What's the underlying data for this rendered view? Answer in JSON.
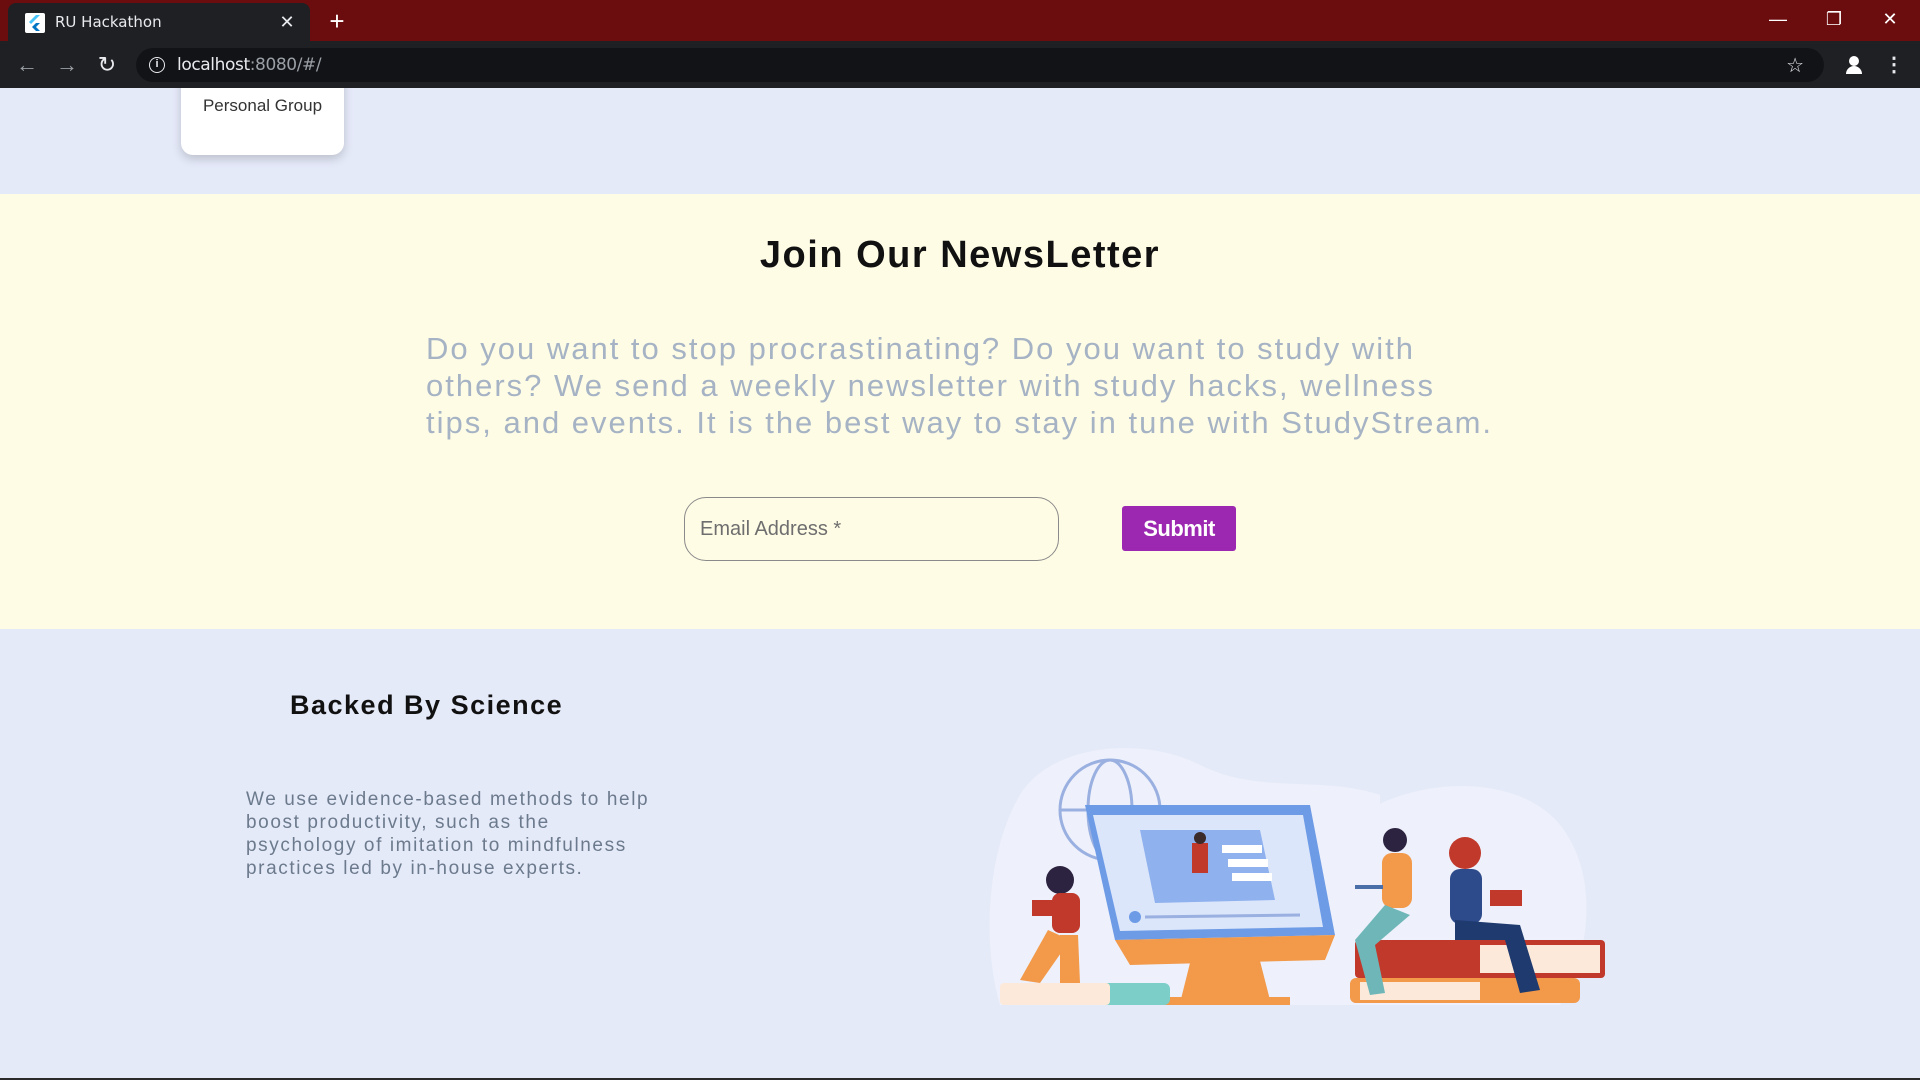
{
  "browser": {
    "tab_title": "RU Hackathon",
    "tab_close": "✕",
    "new_tab": "+",
    "url_host": "localhost",
    "url_rest": ":8080/#/",
    "window_controls": {
      "minimize": "—",
      "restore": "❐",
      "close": "✕"
    }
  },
  "card": {
    "label": "Personal Group"
  },
  "newsletter": {
    "title": "Join Our NewsLetter",
    "body": "Do you want to stop procrastinating? Do you want to study with others? We send a weekly newsletter with study hacks, wellness tips, and events. It is the best way to stay in tune with StudyStream.",
    "email_placeholder": "Email Address *",
    "submit_label": "Submit"
  },
  "science": {
    "title": "Backed By Science",
    "body": "We use evidence-based methods to help boost productivity, such as the psychology of imitation to mindfulness practices led by in-house experts."
  },
  "colors": {
    "tabbar": "#6b0c0e",
    "newsletter_bg": "#fffce6",
    "page_bg": "#e5eaf9",
    "submit_bg": "#9c27b0"
  }
}
